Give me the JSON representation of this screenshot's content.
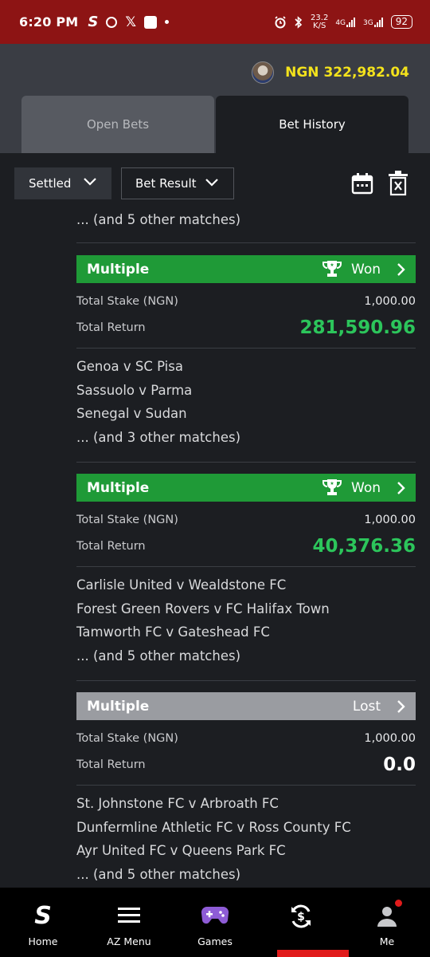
{
  "status_bar": {
    "time": "6:20 PM",
    "net_speed_top": "23.2",
    "net_speed_unit": "K/S",
    "net1": "4G",
    "net2": "3G",
    "battery": "92"
  },
  "header": {
    "balance": "NGN 322,982.04"
  },
  "tabs": [
    {
      "label": "Open Bets",
      "active": false
    },
    {
      "label": "Bet History",
      "active": true
    }
  ],
  "filters": {
    "settled": "Settled",
    "bet_result": "Bet Result"
  },
  "top_partial": "... (and 5 other matches)",
  "bets": [
    {
      "type": "Multiple",
      "result": "Won",
      "stake_label": "Total Stake (NGN)",
      "stake": "1,000.00",
      "return_label": "Total Return",
      "return": "281,590.96",
      "matches": [
        "Genoa v SC Pisa",
        "Sassuolo v Parma",
        "Senegal v Sudan"
      ],
      "more": "... (and 3 other matches)"
    },
    {
      "type": "Multiple",
      "result": "Won",
      "stake_label": "Total Stake (NGN)",
      "stake": "1,000.00",
      "return_label": "Total Return",
      "return": "40,376.36",
      "matches": [
        "Carlisle United v Wealdstone FC",
        "Forest Green Rovers v FC Halifax Town",
        "Tamworth FC v Gateshead FC"
      ],
      "more": "... (and 5 other matches)"
    },
    {
      "type": "Multiple",
      "result": "Lost",
      "stake_label": "Total Stake (NGN)",
      "stake": "1,000.00",
      "return_label": "Total Return",
      "return": "0.0",
      "matches": [
        "St. Johnstone FC v Arbroath FC",
        "Dunfermline Athletic FC v Ross County FC",
        "Ayr United FC v Queens Park FC"
      ],
      "more": "... (and 5 other matches)"
    }
  ],
  "nav": [
    {
      "label": "Home",
      "icon": "sportybet-logo-icon"
    },
    {
      "label": "AZ Menu",
      "icon": "hamburger-menu-icon"
    },
    {
      "label": "Games",
      "icon": "gamepad-icon"
    },
    {
      "label": "",
      "icon": "cashout-icon",
      "active": true
    },
    {
      "label": "Me",
      "icon": "user-icon"
    }
  ],
  "colors": {
    "won": "#1f9a37",
    "lost": "#9a9ca1",
    "return_green": "#2cc55b",
    "balance_yellow": "#f3e21c",
    "status_bar": "#8d1414"
  }
}
